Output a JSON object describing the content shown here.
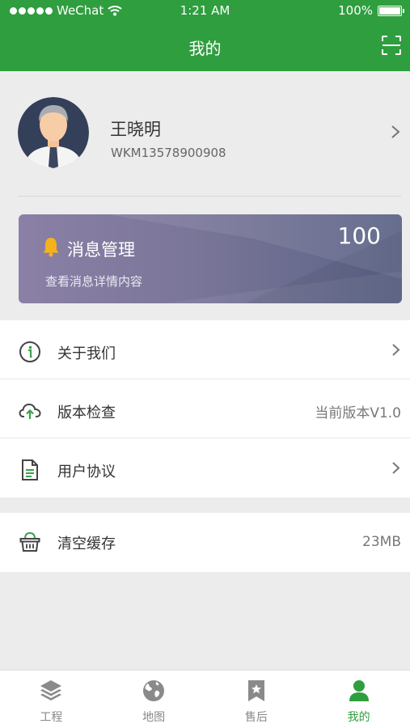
{
  "status_bar": {
    "carrier": "WeChat",
    "time": "1:21 AM",
    "battery": "100%",
    "battery_level": 1.0
  },
  "header": {
    "title": "我的",
    "scan_icon": "scan-icon"
  },
  "profile": {
    "name": "王晓明",
    "id": "WKM13578900908"
  },
  "message_card": {
    "title": "消息管理",
    "count": "100",
    "subtitle": "查看消息详情内容",
    "bell_color": "#f5b21b"
  },
  "menu_group_1": [
    {
      "icon": "info-icon",
      "label": "关于我们",
      "value": "",
      "chevron": true
    },
    {
      "icon": "cloud-upload-icon",
      "label": "版本检查",
      "value": "当前版本V1.0",
      "chevron": false
    },
    {
      "icon": "document-icon",
      "label": "用户协议",
      "value": "",
      "chevron": true
    }
  ],
  "menu_group_2": [
    {
      "icon": "basket-icon",
      "label": "清空缓存",
      "value": "23MB",
      "chevron": false
    }
  ],
  "tab_bar": [
    {
      "icon": "layers-icon",
      "label": "工程",
      "active": false
    },
    {
      "icon": "globe-icon",
      "label": "地图",
      "active": false
    },
    {
      "icon": "bookmark-star-icon",
      "label": "售后",
      "active": false
    },
    {
      "icon": "user-icon",
      "label": "我的",
      "active": true
    }
  ],
  "colors": {
    "brand_green": "#2f9e3f",
    "icon_green": "#3aa14a",
    "inactive_gray": "#888888"
  }
}
